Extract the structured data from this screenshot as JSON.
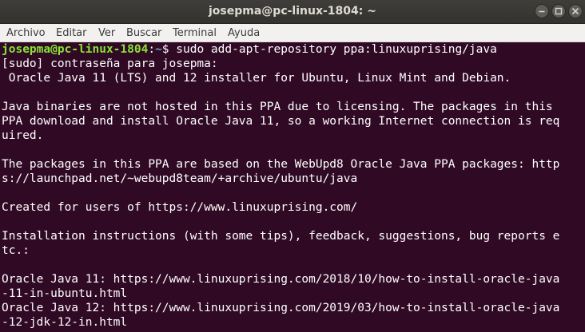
{
  "window": {
    "title": "josepma@pc-linux-1804: ~"
  },
  "menubar": {
    "items": [
      "Archivo",
      "Editar",
      "Ver",
      "Buscar",
      "Terminal",
      "Ayuda"
    ]
  },
  "terminal": {
    "prompt": {
      "user_host": "josepma@pc-linux-1804",
      "separator": ":",
      "path": "~",
      "symbol": "$ ",
      "command": "sudo add-apt-repository ppa:linuxuprising/java"
    },
    "lines": [
      "[sudo] contraseña para josepma:",
      " Oracle Java 11 (LTS) and 12 installer for Ubuntu, Linux Mint and Debian.",
      "",
      "Java binaries are not hosted in this PPA due to licensing. The packages in this",
      "PPA download and install Oracle Java 11, so a working Internet connection is req",
      "uired.",
      "",
      "The packages in this PPA are based on the WebUpd8 Oracle Java PPA packages: http",
      "s://launchpad.net/~webupd8team/+archive/ubuntu/java",
      "",
      "Created for users of https://www.linuxuprising.com/",
      "",
      "Installation instructions (with some tips), feedback, suggestions, bug reports e",
      "tc.:",
      "",
      "Oracle Java 11: https://www.linuxuprising.com/2018/10/how-to-install-oracle-java",
      "-11-in-ubuntu.html",
      "Oracle Java 12: https://www.linuxuprising.com/2019/03/how-to-install-oracle-java",
      "-12-jdk-12-in.html"
    ]
  },
  "colors": {
    "terminal_background": "#300a24",
    "terminal_text": "#ffffff",
    "prompt_user": "#8ae234",
    "prompt_path": "#729fcf",
    "titlebar": "#3c3b37",
    "menubar": "#f2f1f0"
  },
  "icons": {
    "minimize": "minimize-icon",
    "maximize": "maximize-icon",
    "close": "close-icon"
  }
}
